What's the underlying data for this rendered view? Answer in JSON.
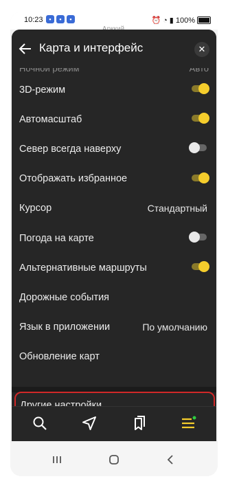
{
  "statusbar": {
    "time": "10:23",
    "battery": "100%"
  },
  "map_label": "Арккий",
  "header": {
    "title": "Карта и интерфейс"
  },
  "partial_row": {
    "label": "Ночной режим",
    "value": "Авто"
  },
  "rows": [
    {
      "label": "3D-режим",
      "toggle": "on"
    },
    {
      "label": "Автомасштаб",
      "toggle": "on"
    },
    {
      "label": "Север всегда наверху",
      "toggle": "off"
    },
    {
      "label": "Отображать избранное",
      "toggle": "on"
    },
    {
      "label": "Курсор",
      "value": "Стандартный"
    },
    {
      "label": "Погода на карте",
      "toggle": "off"
    },
    {
      "label": "Альтернативные маршруты",
      "toggle": "on"
    },
    {
      "label": "Дорожные события"
    },
    {
      "label": "Язык в приложении",
      "value": "По умолчанию"
    },
    {
      "label": "Обновление карт"
    }
  ],
  "other_settings": {
    "label": "Другие настройки"
  },
  "colors": {
    "accent": "#f5cd2c",
    "highlight": "#d12828",
    "sheet": "#262626"
  }
}
